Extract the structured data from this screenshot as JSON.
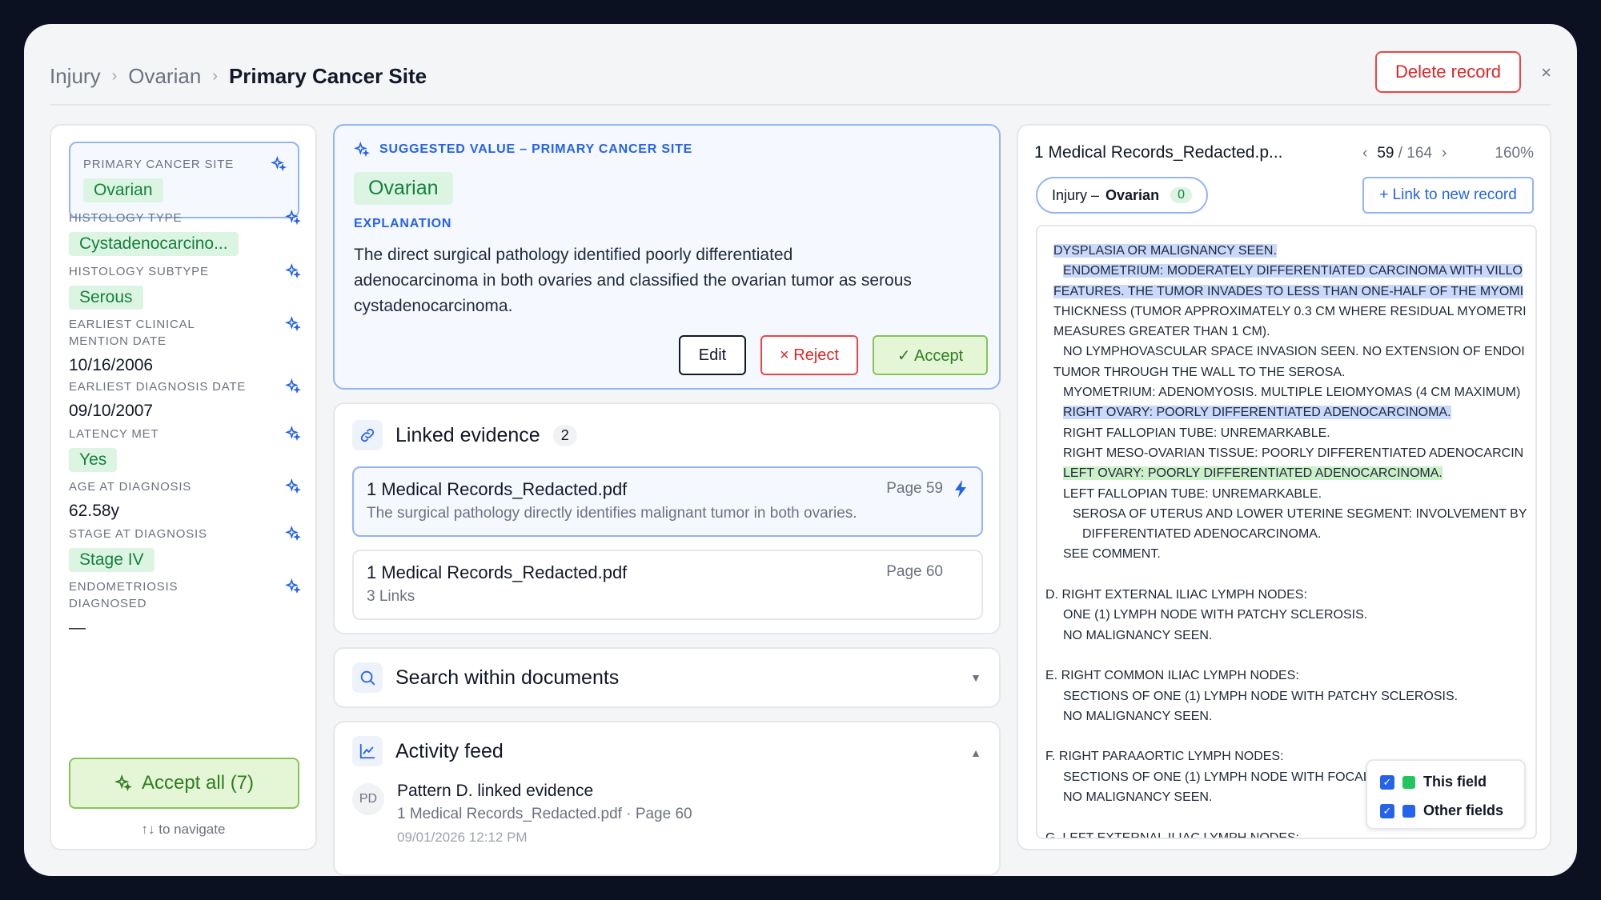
{
  "breadcrumb": {
    "items": [
      "Injury",
      "Ovarian"
    ],
    "current": "Primary Cancer Site"
  },
  "header": {
    "delete_label": "Delete record",
    "close_glyph": "×"
  },
  "fields": [
    {
      "label": "PRIMARY CANCER SITE",
      "value": "Ovarian",
      "chip": true
    },
    {
      "label": "HISTOLOGY TYPE",
      "value": "Cystadenocarcino...",
      "chip": true
    },
    {
      "label": "HISTOLOGY SUBTYPE",
      "value": "Serous",
      "chip": true
    },
    {
      "label": "EARLIEST CLINICAL MENTION DATE",
      "value": "10/16/2006",
      "chip": false
    },
    {
      "label": "EARLIEST DIAGNOSIS DATE",
      "value": "09/10/2007",
      "chip": false
    },
    {
      "label": "LATENCY MET",
      "value": "Yes",
      "chip": true
    },
    {
      "label": "AGE AT DIAGNOSIS",
      "value": "62.58y",
      "chip": false
    },
    {
      "label": "STAGE AT DIAGNOSIS",
      "value": "Stage IV",
      "chip": true
    },
    {
      "label": "ENDOMETRIOSIS DIAGNOSED",
      "value": "—",
      "chip": false
    }
  ],
  "left": {
    "accept_all": "Accept all (7)",
    "nav_hint": "↑↓ to navigate"
  },
  "suggest": {
    "heading": "SUGGESTED VALUE – PRIMARY CANCER SITE",
    "value": "Ovarian",
    "explanation_label": "EXPLANATION",
    "explanation": "The direct surgical pathology identified poorly differentiated adenocarcinoma in both ovaries and classified the ovarian tumor as serous cystadenocarcinoma.",
    "edit": "Edit",
    "reject": "× Reject",
    "accept": "✓ Accept"
  },
  "linked": {
    "title": "Linked evidence",
    "count": "2",
    "items": [
      {
        "name": "1 Medical Records_Redacted.pdf",
        "sub": "The surgical pathology directly identifies malignant tumor in both ovaries.",
        "page": "Page 59"
      },
      {
        "name": "1 Medical Records_Redacted.pdf",
        "sub": "3 Links",
        "page": "Page 60"
      }
    ]
  },
  "search": {
    "title": "Search within documents"
  },
  "activity": {
    "title": "Activity feed",
    "avatar": "PD",
    "entry_title": "Pattern D. linked evidence",
    "entry_sub": "1 Medical Records_Redacted.pdf · Page 60",
    "entry_time": "09/01/2026 12:12 PM"
  },
  "doc": {
    "name": "1 Medical Records_Redacted.p...",
    "page_current": "59",
    "page_total": "/ 164",
    "zoom": "160%",
    "pill_prefix": "Injury –",
    "pill_value": "Ovarian",
    "pill_count": "0",
    "link_btn": "+ Link to new record",
    "lines": [
      {
        "t": "DYSPLASIA OR MALIGNANCY SEEN.",
        "hl": "blue",
        "indent": 0
      },
      {
        "t": "ENDOMETRIUM: MODERATELY DIFFERENTIATED CARCINOMA WITH VILLO",
        "hl": "blue",
        "indent": 1
      },
      {
        "t": "FEATURES. THE TUMOR INVADES TO LESS THAN ONE-HALF OF THE MYOMI",
        "hl": "blue",
        "indent": 0
      },
      {
        "t": "THICKNESS (TUMOR APPROXIMATELY 0.3 CM WHERE RESIDUAL MYOMETRI",
        "hl": "",
        "indent": 0
      },
      {
        "t": "MEASURES GREATER THAN 1 CM).",
        "hl": "",
        "indent": 0
      },
      {
        "t": "NO LYMPHOVASCULAR SPACE INVASION SEEN. NO EXTENSION OF ENDOI",
        "hl": "",
        "indent": 1
      },
      {
        "t": "TUMOR THROUGH THE WALL TO THE SEROSA.",
        "hl": "",
        "indent": 0
      },
      {
        "t": "MYOMETRIUM: ADENOMYOSIS. MULTIPLE LEIOMYOMAS (4 CM MAXIMUM)",
        "hl": "",
        "indent": 1
      },
      {
        "t": "RIGHT OVARY: POORLY DIFFERENTIATED ADENOCARCINOMA.",
        "hl": "blue",
        "indent": 1
      },
      {
        "t": "RIGHT FALLOPIAN TUBE: UNREMARKABLE.",
        "hl": "",
        "indent": 1
      },
      {
        "t": "RIGHT MESO-OVARIAN TISSUE: POORLY DIFFERENTIATED ADENOCARCIN",
        "hl": "",
        "indent": 1
      },
      {
        "t": "LEFT OVARY: POORLY DIFFERENTIATED ADENOCARCINOMA.",
        "hl": "green",
        "indent": 1
      },
      {
        "t": "LEFT FALLOPIAN TUBE: UNREMARKABLE.",
        "hl": "",
        "indent": 1
      },
      {
        "t": "SEROSA OF UTERUS AND LOWER UTERINE SEGMENT: INVOLVEMENT BY",
        "hl": "",
        "indent": 2
      },
      {
        "t": "DIFFERENTIATED ADENOCARCINOMA.",
        "hl": "",
        "indent": 3
      },
      {
        "t": "SEE COMMENT.",
        "hl": "",
        "indent": 1
      },
      {
        "t": "",
        "hl": "",
        "indent": 0
      },
      {
        "t": "D. RIGHT EXTERNAL ILIAC LYMPH NODES:",
        "hl": "",
        "indent": -1
      },
      {
        "t": "ONE (1) LYMPH NODE WITH PATCHY SCLEROSIS.",
        "hl": "",
        "indent": 1
      },
      {
        "t": "NO MALIGNANCY SEEN.",
        "hl": "",
        "indent": 1
      },
      {
        "t": "",
        "hl": "",
        "indent": 0
      },
      {
        "t": "E. RIGHT COMMON ILIAC LYMPH NODES:",
        "hl": "",
        "indent": -1
      },
      {
        "t": "SECTIONS OF ONE (1) LYMPH NODE WITH PATCHY SCLEROSIS.",
        "hl": "",
        "indent": 1
      },
      {
        "t": "NO MALIGNANCY SEEN.",
        "hl": "",
        "indent": 1
      },
      {
        "t": "",
        "hl": "",
        "indent": 0
      },
      {
        "t": "F. RIGHT PARAAORTIC LYMPH NODES:",
        "hl": "",
        "indent": -1
      },
      {
        "t": "SECTIONS OF ONE (1) LYMPH NODE WITH FOCAL",
        "hl": "",
        "indent": 1
      },
      {
        "t": "NO MALIGNANCY SEEN.",
        "hl": "",
        "indent": 1
      },
      {
        "t": "",
        "hl": "",
        "indent": 0
      },
      {
        "t": "G. LEFT EXTERNAL ILIAC LYMPH NODES:",
        "hl": "",
        "indent": -1
      }
    ],
    "legend": [
      {
        "label": "This field",
        "color": "#22c55e"
      },
      {
        "label": "Other fields",
        "color": "#2563eb"
      }
    ]
  }
}
